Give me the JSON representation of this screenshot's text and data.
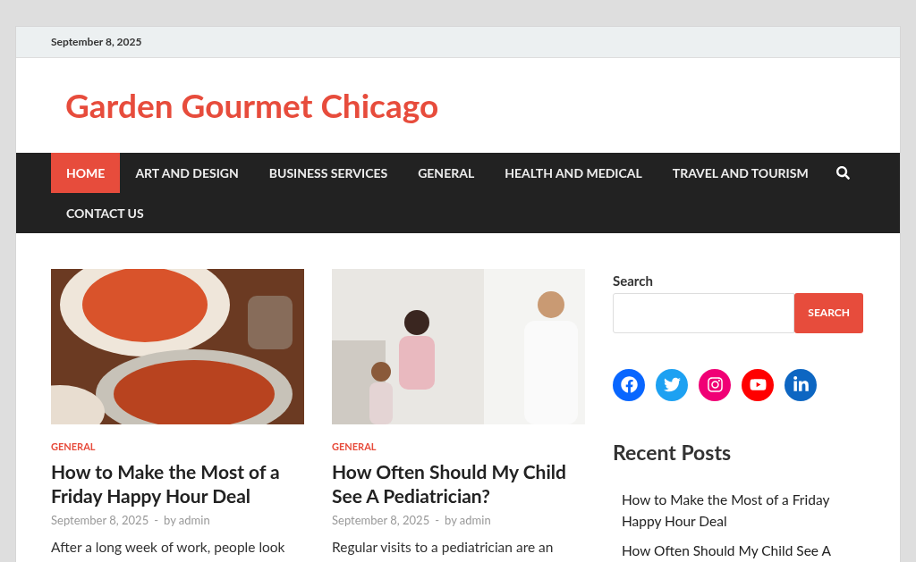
{
  "top_bar": {
    "date": "September 8, 2025"
  },
  "site_title": "Garden Gourmet Chicago",
  "nav": {
    "items": [
      {
        "label": "HOME",
        "selected": true
      },
      {
        "label": "ART AND DESIGN",
        "selected": false
      },
      {
        "label": "BUSINESS SERVICES",
        "selected": false
      },
      {
        "label": "GENERAL",
        "selected": false
      },
      {
        "label": "HEALTH AND MEDICAL",
        "selected": false
      },
      {
        "label": "TRAVEL AND TOURISM",
        "selected": false
      },
      {
        "label": "CONTACT US",
        "selected": false
      }
    ]
  },
  "posts": [
    {
      "category": "GENERAL",
      "title": "How to Make the Most of a Friday Happy Hour Deal",
      "date": "September 8, 2025",
      "separator": "-",
      "author": "by admin",
      "excerpt": "After a long week of work, people look",
      "kind": "food"
    },
    {
      "category": "GENERAL",
      "title": "How Often Should My Child See A Pediatrician?",
      "date": "September 8, 2025",
      "separator": "-",
      "author": "by admin",
      "excerpt": "Regular visits to a pediatrician are an",
      "kind": "clinic"
    }
  ],
  "sidebar": {
    "search_label": "Search",
    "search_button": "SEARCH",
    "social": [
      {
        "kind": "facebook",
        "color": "#0866ff"
      },
      {
        "kind": "twitter",
        "color": "#1da1f2"
      },
      {
        "kind": "instagram",
        "color": "#f00075"
      },
      {
        "kind": "youtube",
        "color": "#ff0000"
      },
      {
        "kind": "linkedin",
        "color": "#0d66c2"
      }
    ],
    "recent_title": "Recent Posts",
    "recent_posts": [
      "How to Make the Most of a Friday Happy Hour Deal",
      "How Often Should My Child See A"
    ]
  }
}
